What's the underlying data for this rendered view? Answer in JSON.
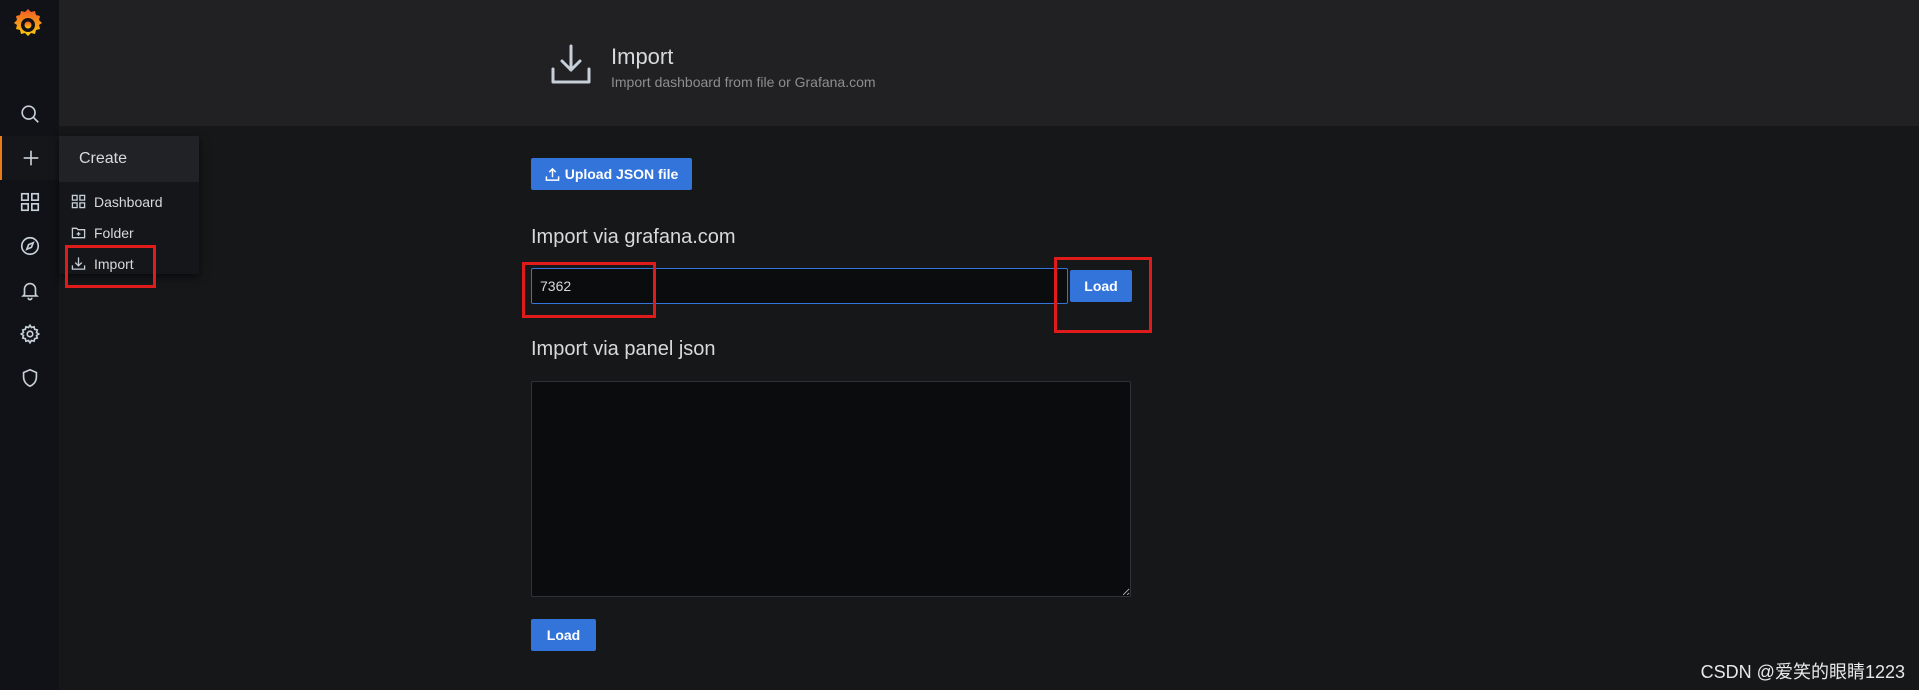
{
  "sidebar": {
    "logo": "grafana-logo",
    "items": [
      {
        "name": "search-icon"
      },
      {
        "name": "plus-icon"
      },
      {
        "name": "dashboards-icon"
      },
      {
        "name": "compass-icon"
      },
      {
        "name": "bell-icon"
      },
      {
        "name": "gear-icon"
      },
      {
        "name": "shield-icon"
      }
    ]
  },
  "create_menu": {
    "header": "Create",
    "items": [
      {
        "label": "Dashboard",
        "icon": "apps-icon"
      },
      {
        "label": "Folder",
        "icon": "folder-plus-icon"
      },
      {
        "label": "Import",
        "icon": "import-icon"
      }
    ]
  },
  "page_header": {
    "icon": "import-icon",
    "title": "Import",
    "subtitle": "Import dashboard from file or Grafana.com"
  },
  "upload": {
    "label": "Upload JSON file",
    "icon": "upload-icon"
  },
  "grafana_com": {
    "title": "Import via grafana.com",
    "input_value": "7362",
    "load_label": "Load"
  },
  "panel_json": {
    "title": "Import via panel json",
    "value": "",
    "load_label": "Load"
  },
  "watermark": "CSDN @爱笑的眼睛1223",
  "colors": {
    "accent": "#3274d9",
    "annotation": "#e01b1b",
    "active_border": "#eb7b18",
    "background": "#161719",
    "sidebar": "#111217"
  }
}
